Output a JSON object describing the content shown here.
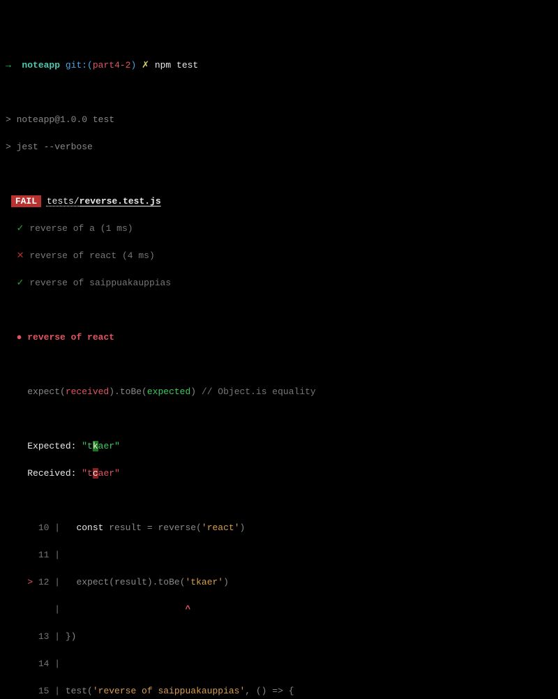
{
  "prompt": {
    "arrow": "→",
    "dir": "noteapp",
    "git_prefix": "git:(",
    "branch": "part4-2",
    "git_suffix": ")",
    "dirty": "✗",
    "command": "npm test"
  },
  "runner": {
    "line1_gt": ">",
    "line1": "noteapp@1.0.0 test",
    "line2_gt": ">",
    "line2": "jest --verbose"
  },
  "fail": {
    "badge": "FAIL",
    "dir": "tests/",
    "file": "reverse.test.js"
  },
  "results": [
    {
      "mark": "✓",
      "text": "reverse of a",
      "time": "(1 ms)"
    },
    {
      "mark": "✕",
      "text": "reverse of react",
      "time": "(4 ms)"
    },
    {
      "mark": "✓",
      "text": "reverse of saippuakauppias",
      "time": ""
    }
  ],
  "failure": {
    "bullet": "●",
    "name": "reverse of react",
    "expect_pre": "expect(",
    "expect_received": "received",
    "expect_mid1": ").toBe(",
    "expect_expected": "expected",
    "expect_mid2": ")",
    "comment": " // Object.is equality",
    "expected_label": "Expected: ",
    "expected_q": "\"",
    "expected_pre": "t",
    "expected_diff": "k",
    "expected_post": "aer",
    "received_label": "Received: ",
    "received_pre": "t",
    "received_diff": "c",
    "received_post": "aer"
  },
  "code": {
    "l10_num": "10",
    "l10_pipe": " |   ",
    "l10_const": "const",
    "l10_mid": " result = reverse(",
    "l10_str": "'react'",
    "l10_end": ")",
    "l11_num": "11",
    "l11_pipe": " |",
    "l12_caret": ">",
    "l12_num": "12",
    "l12_pipe": " |   ",
    "l12_text": "expect(result).toBe(",
    "l12_str": "'tkaer'",
    "l12_end": ")",
    "caret_pipe": "   |",
    "caret_spaces": "                       ",
    "caret": "^",
    "l13_num": "13",
    "l13_pipe": " | ",
    "l13_text": "})",
    "l14_num": "14",
    "l14_pipe": " |",
    "l15_num": "15",
    "l15_pipe": " | ",
    "l15_text1": "test(",
    "l15_str": "'reverse of saippuakauppias'",
    "l15_text2": ", () => {"
  }
}
